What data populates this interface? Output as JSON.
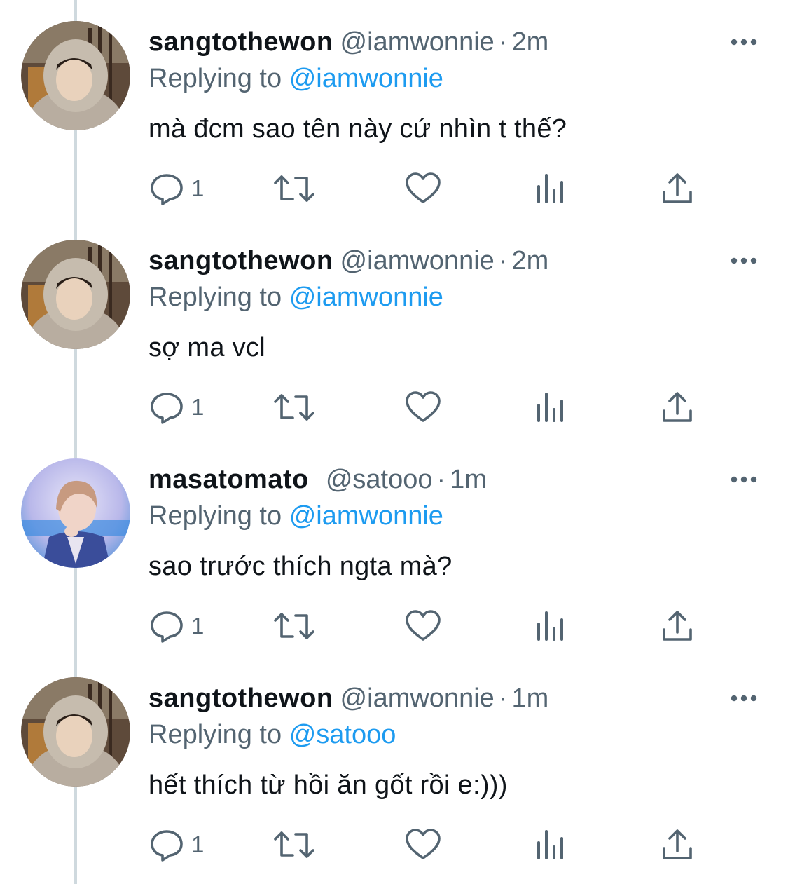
{
  "tweets": [
    {
      "name": "sangtothewon",
      "handle": "@iamwonnie",
      "sep": "·",
      "time": "2m",
      "replying_prefix": "Replying to",
      "replying_to": "@iamwonnie",
      "text": "mà đcm sao tên này cứ nhìn t thế?",
      "reply_count": "1",
      "avatar": "avatar-photo-hoodie"
    },
    {
      "name": "sangtothewon",
      "handle": "@iamwonnie",
      "sep": "·",
      "time": "2m",
      "replying_prefix": "Replying to",
      "replying_to": "@iamwonnie",
      "text": "sợ ma vcl",
      "reply_count": "1",
      "avatar": "avatar-photo-hoodie"
    },
    {
      "name": "masatomato",
      "handle": "@satooo",
      "sep": "·",
      "time": "1m",
      "replying_prefix": "Replying to",
      "replying_to": "@iamwonnie",
      "text": "sao trước thích ngta mà?",
      "reply_count": "1",
      "avatar": "avatar-photo-stage"
    },
    {
      "name": "sangtothewon",
      "handle": "@iamwonnie",
      "sep": "·",
      "time": "1m",
      "replying_prefix": "Replying to",
      "replying_to": "@satooo",
      "text": "hết thích từ hồi ăn gốt rồi e:)))",
      "reply_count": "1",
      "avatar": "avatar-photo-hoodie"
    }
  ],
  "icons": {
    "reply": "reply-icon",
    "retweet": "retweet-icon",
    "like": "like-icon",
    "views": "views-icon",
    "share": "share-icon",
    "more": "more-icon"
  },
  "colors": {
    "text": "#0f1419",
    "secondary": "#536471",
    "link": "#1d9bf0",
    "thread_line": "#cfd9de"
  }
}
